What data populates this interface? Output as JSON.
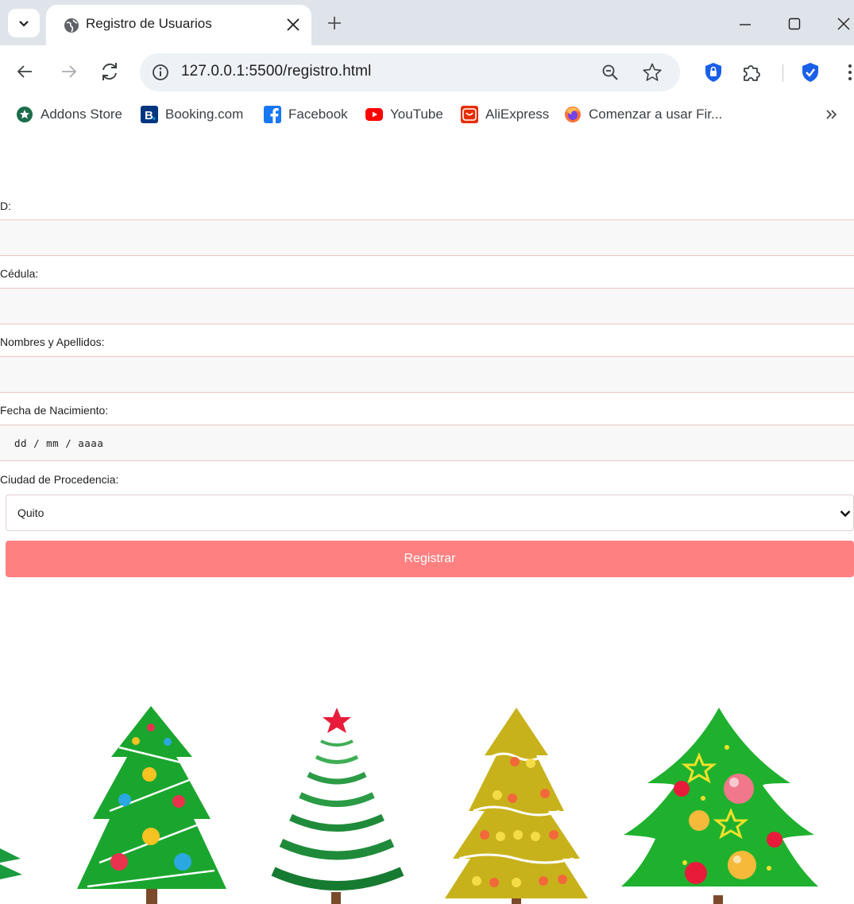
{
  "browser": {
    "tab_title": "Registro de Usuarios",
    "url": "127.0.0.1:5500/registro.html",
    "bookmarks": [
      {
        "label": "Addons Store",
        "icon": "addons-store-icon",
        "color": "#1b6e4a"
      },
      {
        "label": "Booking.com",
        "icon": "booking-icon",
        "color": "#003580"
      },
      {
        "label": "Facebook",
        "icon": "facebook-icon",
        "color": "#1877f2"
      },
      {
        "label": "YouTube",
        "icon": "youtube-icon",
        "color": "#ff0000"
      },
      {
        "label": "AliExpress",
        "icon": "aliexpress-icon",
        "color": "#e62e04"
      },
      {
        "label": "Comenzar a usar Fir...",
        "icon": "firefox-icon",
        "color": "#ff7139"
      }
    ]
  },
  "form": {
    "fields": [
      {
        "label": "D:",
        "value": ""
      },
      {
        "label": "Cédula:",
        "value": ""
      },
      {
        "label": "Nombres y Apellidos:",
        "value": ""
      },
      {
        "label": "Fecha de Nacimiento:",
        "value": "dd / mm / aaaa"
      },
      {
        "label": "Ciudad de Procedencia:",
        "value": "Quito"
      }
    ],
    "submit_label": "Registrar",
    "accent_color": "#ff8080"
  }
}
